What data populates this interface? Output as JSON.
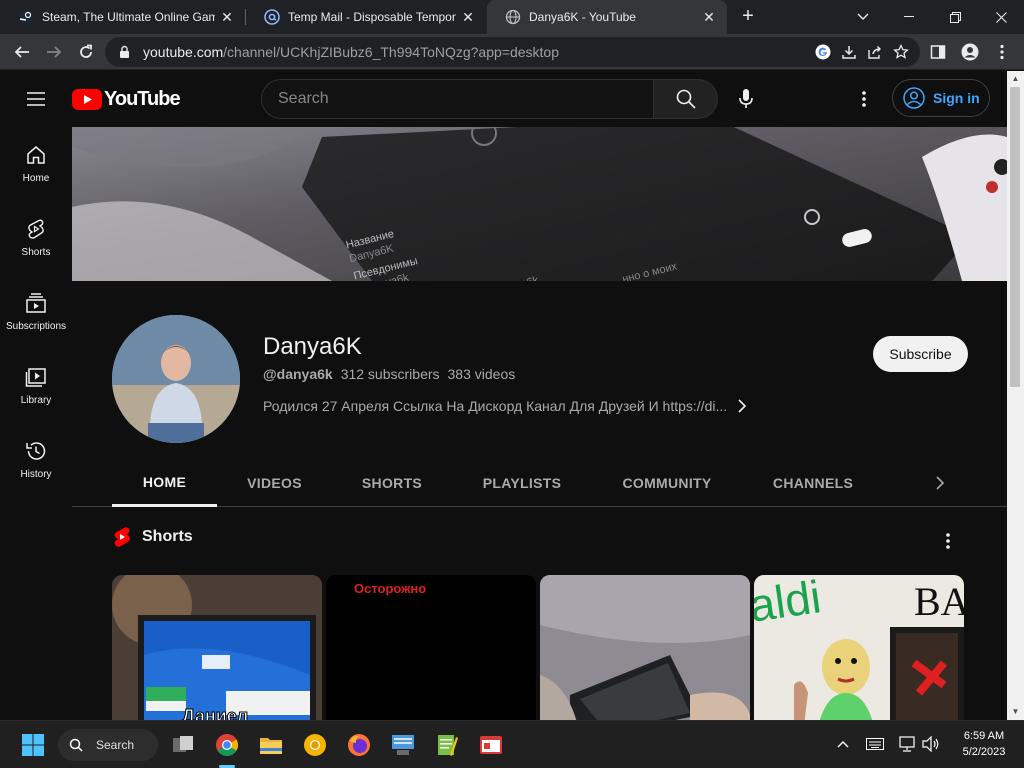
{
  "browser": {
    "tabs": [
      {
        "title": "Steam, The Ultimate Online Gam",
        "close": "✕"
      },
      {
        "title": "Temp Mail - Disposable Tempora",
        "close": "✕"
      },
      {
        "title": "Danya6K - YouTube",
        "close": "✕"
      }
    ],
    "new_tab": "+",
    "url_host": "youtube.com",
    "url_path": "/channel/UCKhjZIBubz6_Th994ToNQzg?app=desktop"
  },
  "masthead": {
    "logo_text": "YouTube",
    "search_placeholder": "Search",
    "sign_in": "Sign in"
  },
  "guide": [
    {
      "label": "Home",
      "icon": "home-icon"
    },
    {
      "label": "Shorts",
      "icon": "shorts-icon"
    },
    {
      "label": "Subscriptions",
      "icon": "subscriptions-icon"
    },
    {
      "label": "Library",
      "icon": "library-icon"
    },
    {
      "label": "History",
      "icon": "history-icon"
    }
  ],
  "channel": {
    "name": "Danya6K",
    "handle": "@danya6k",
    "subscribers": "312 subscribers",
    "videos": "383 videos",
    "description": "Родился 27 Апреля Ссылка На Дискорд Канал Для Друзей И https://di...",
    "subscribe_label": "Subscribe"
  },
  "channel_tabs": [
    "HOME",
    "VIDEOS",
    "SHORTS",
    "PLAYLISTS",
    "COMMUNITY",
    "CHANNELS"
  ],
  "shelf": {
    "title": "Shorts",
    "items": [
      {
        "overlay": "Даниел"
      },
      {
        "overlay": "Осторожно"
      },
      {
        "overlay": ""
      },
      {
        "overlay": ""
      }
    ]
  },
  "taskbar": {
    "search_label": "Search",
    "time": "6:59 AM",
    "date": "5/2/2023"
  },
  "colors": {
    "yt_red": "#ff0000",
    "yt_bg": "#0f0f0f",
    "link_blue": "#3ea6ff"
  }
}
